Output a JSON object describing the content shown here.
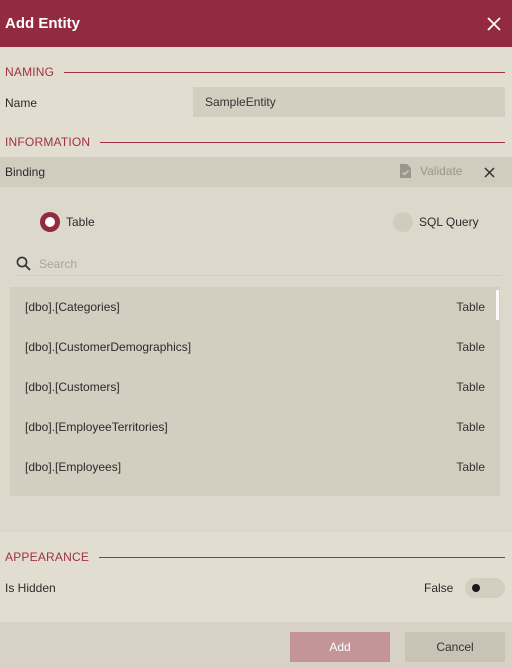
{
  "dialog": {
    "title": "Add Entity"
  },
  "naming": {
    "section_label": "NAMING",
    "name_label": "Name",
    "name_value": "SampleEntity"
  },
  "information": {
    "section_label": "INFORMATION",
    "binding_label": "Binding",
    "validate_label": "Validate",
    "source_options": [
      {
        "label": "Table",
        "selected": true
      },
      {
        "label": "SQL Query",
        "selected": false
      }
    ],
    "search_placeholder": "Search",
    "tables": [
      {
        "name": "[dbo].[Categories]",
        "kind": "Table"
      },
      {
        "name": "[dbo].[CustomerDemographics]",
        "kind": "Table"
      },
      {
        "name": "[dbo].[Customers]",
        "kind": "Table"
      },
      {
        "name": "[dbo].[EmployeeTerritories]",
        "kind": "Table"
      },
      {
        "name": "[dbo].[Employees]",
        "kind": "Table"
      }
    ]
  },
  "appearance": {
    "section_label": "APPEARANCE",
    "is_hidden_label": "Is Hidden",
    "is_hidden_value": "False"
  },
  "footer": {
    "add_label": "Add",
    "cancel_label": "Cancel"
  },
  "colors": {
    "accent": "#922b3f",
    "background": "#e2ddd1",
    "field": "#d3cebf",
    "add_button_disabled": "#c49596"
  },
  "icons": {
    "close": "close-icon",
    "validate": "document-check-icon",
    "search": "search-icon"
  }
}
